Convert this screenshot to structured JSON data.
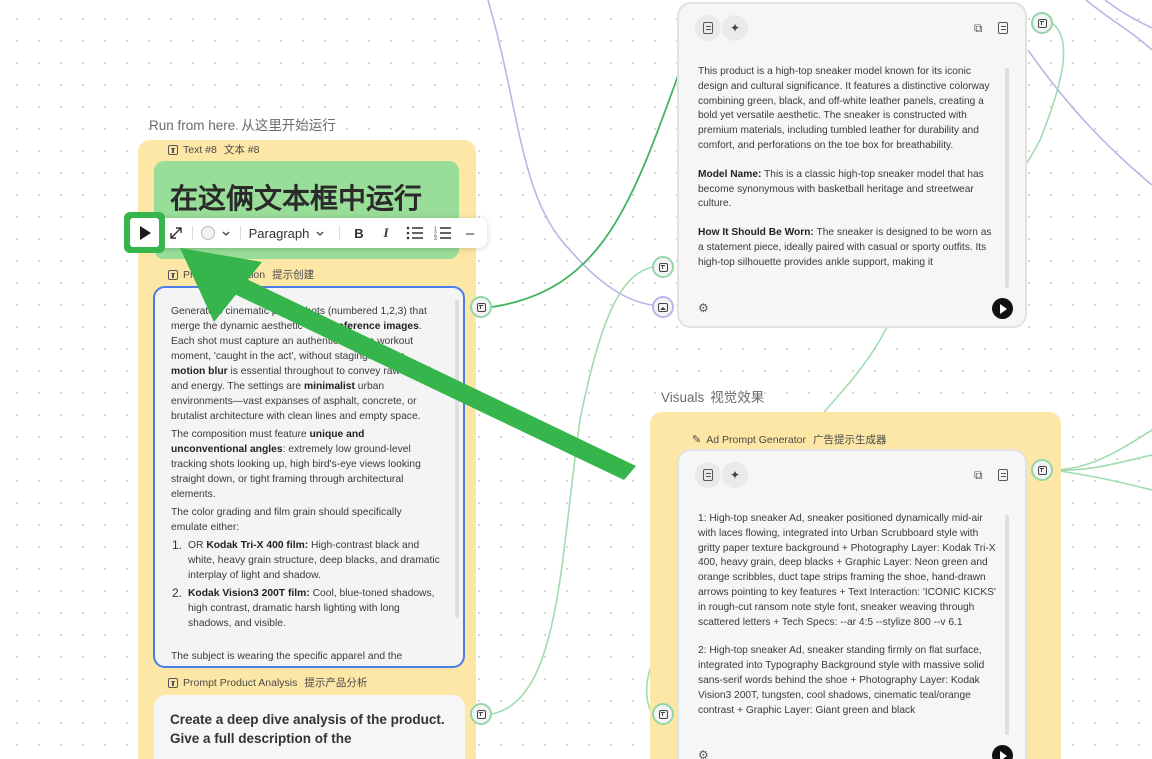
{
  "groups": {
    "run_from_here": {
      "label_en": "Run from here",
      "label_zh": "从这里开始运行"
    },
    "visuals": {
      "label_en": "Visuals",
      "label_zh": "视觉效果"
    }
  },
  "text_node": {
    "header_en": "Text #8",
    "header_zh": "文本 #8",
    "content": "在这俩文本框中运行"
  },
  "toolbar": {
    "run_icon": "play-icon",
    "expand_icon": "expand-icon",
    "color_icon": "color-circle",
    "paragraph_label": "Paragraph",
    "bold_label": "B",
    "italic_label": "I",
    "bullet_icon": "bullet-list-icon",
    "numbered_icon": "numbered-list-icon",
    "minus_label": "–"
  },
  "prompt_node": {
    "header_en": "Prompt Creation",
    "header_en_visible": "Pro",
    "header_en_tail": "ation",
    "header_zh": "提示创建",
    "p1_a": "Generate 3 cinematic photo shots (numbered 1,2,3) that merge the dynamic aesthetic of the ",
    "p1_b": "reference images",
    "p1_c": ". Each shot must capture an authentic intense workout moment, 'caught in the act', without staging. ",
    "p1_d": "Heavy motion blur",
    "p1_e": " is essential throughout to convey raw speed and energy. The settings are ",
    "p1_f": "minimalist",
    "p1_g": " urban environments—vast expanses of asphalt, concrete, or brutalist architecture with clean lines and empty space.",
    "p2_a": "The composition must feature ",
    "p2_b": "unique and unconventional angles",
    "p2_c": ": extremely low ground-level tracking shots looking up, high bird's-eye views looking straight down, or tight framing through architectural elements.",
    "p3": "The color grading and film grain should specifically emulate either:",
    "li1_num": "1.",
    "li1_a": "OR ",
    "li1_b": "Kodak Tri-X 400 film:",
    "li1_c": " High-contrast black and white, heavy grain structure, deep blacks, and dramatic interplay of light and shadow.",
    "li2_num": "2.",
    "li2_b": "Kodak Vision3 200T film:",
    "li2_c": " Cool, blue-toned shadows, high contrast, dramatic harsh lighting with long shadows, and visible.",
    "p4": "The subject is wearing the specific apparel and the"
  },
  "analysis_node": {
    "header_en": "Prompt Product Analysis",
    "header_zh": "提示产品分析",
    "content": "Create a deep dive analysis of the product. Give a full description of the"
  },
  "analysis_card": {
    "p1": "This product is a high-top sneaker model known for its iconic design and cultural significance. It features a distinctive colorway combining green, black, and off-white leather panels, creating a bold yet versatile aesthetic. The sneaker is constructed with premium materials, including tumbled leather for durability and comfort, and perforations on the toe box for breathability.",
    "p2_label": "Model Name:",
    "p2_text": " This is a classic high-top sneaker model that has become synonymous with basketball heritage and streetwear culture.",
    "p3_label": "How It Should Be Worn:",
    "p3_text": " The sneaker is designed to be worn as a statement piece, ideally paired with casual or sporty outfits. Its high-top silhouette provides ankle support, making it"
  },
  "ad_generator": {
    "header_en": "Ad Prompt Generator",
    "header_zh": "广告提示生成器",
    "p1": "1: High-top sneaker Ad, sneaker positioned dynamically mid-air with laces flowing, integrated into Urban Scrubboard style with gritty paper texture background + Photography Layer: Kodak Tri-X 400, heavy grain, deep blacks + Graphic Layer: Neon green and orange scribbles, duct tape strips framing the shoe, hand-drawn arrows pointing to key features + Text Interaction: 'ICONIC KICKS' in rough-cut ransom note style font, sneaker weaving through scattered letters + Tech Specs: --ar 4:5 --stylize 800 --v 6.1",
    "p2": "2: High-top sneaker Ad, sneaker standing firmly on flat surface, integrated into Typography Background style with massive solid sans-serif words behind the shoe + Photography Layer: Kodak Vision3 200T, tungsten, cool shadows, cinematic teal/orange contrast + Graphic Layer: Giant green and black"
  },
  "icons": {
    "text_icon": "▤",
    "sparkle_icon": "✦",
    "copy_icon": "⧉",
    "gear_icon": "⚙"
  },
  "colors": {
    "group_yellow": "#fde7a6",
    "text_node_green": "#98dd98",
    "selected_border": "#4a7ee8",
    "annotation_green": "#35b54b",
    "wire_green": "#93d6a8",
    "wire_purple": "#b8b6e6"
  }
}
